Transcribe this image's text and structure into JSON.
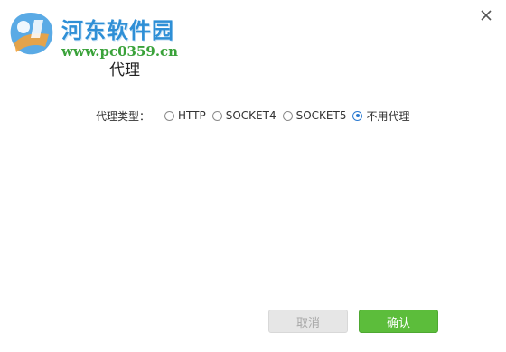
{
  "watermark": {
    "brand_cn": "河东软件园",
    "brand_url": "www.pc0359.cn"
  },
  "dialog": {
    "title": "代理",
    "close_icon": "close-icon"
  },
  "proxy": {
    "label": "代理类型：",
    "options": [
      {
        "label": "HTTP",
        "checked": false
      },
      {
        "label": "SOCKET4",
        "checked": false
      },
      {
        "label": "SOCKET5",
        "checked": false
      },
      {
        "label": "不用代理",
        "checked": true
      }
    ]
  },
  "buttons": {
    "cancel": "取消",
    "confirm": "确认"
  },
  "colors": {
    "confirm_bg": "#5cbd3b",
    "cancel_bg": "#e6e6e6",
    "watermark_blue": "#2e8fd6",
    "watermark_green": "#3aa23a"
  }
}
